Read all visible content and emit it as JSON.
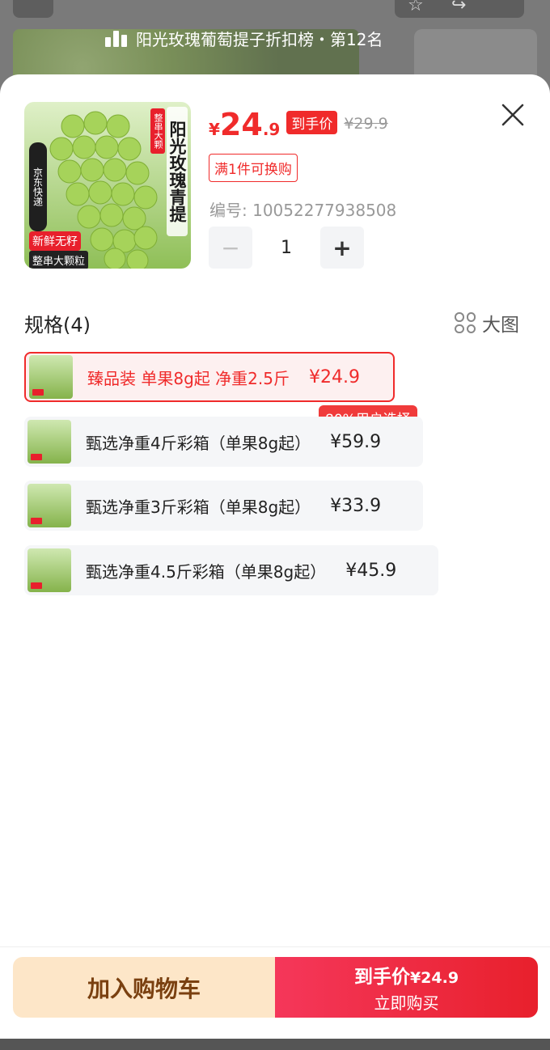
{
  "background": {
    "rank_text": "阳光玫瑰葡萄提子折扣榜・第12名"
  },
  "product": {
    "image_tags": {
      "vertical_title": "阳光玫瑰青提",
      "vertical_badge": "整串大颗",
      "side_label": "京东快递",
      "red_label": "新鲜无籽",
      "black_label": "整串大颗粒"
    },
    "price_symbol": "¥",
    "price_int": "24",
    "price_dec": ".9",
    "price_badge": "到手价",
    "original_price": "¥29.9",
    "promo": "满1件可换购",
    "sku": "编号: 10052277938508",
    "quantity": "1"
  },
  "specs": {
    "title": "规格(4)",
    "big_view": "大图",
    "options": [
      {
        "label": "臻品装 单果8g起 净重2.5斤",
        "price": "¥24.9",
        "selected": true
      },
      {
        "label": "甄选净重4斤彩箱（单果8g起）",
        "price": "¥59.9",
        "selected": false
      },
      {
        "label": "甄选净重3斤彩箱（单果8g起）",
        "price": "¥33.9",
        "selected": false
      },
      {
        "label": "甄选净重4.5斤彩箱（单果8g起）",
        "price": "¥45.9",
        "selected": false
      }
    ],
    "recommend_badge": "80%用户选择"
  },
  "bottom": {
    "cart_label": "加入购物车",
    "buy_line1": "到手价",
    "buy_price": "¥24.9",
    "buy_line2": "立即购买"
  },
  "colors": {
    "accent": "#f02b2b",
    "cart_bg": "#fde6c8",
    "cart_text": "#7a4010"
  }
}
